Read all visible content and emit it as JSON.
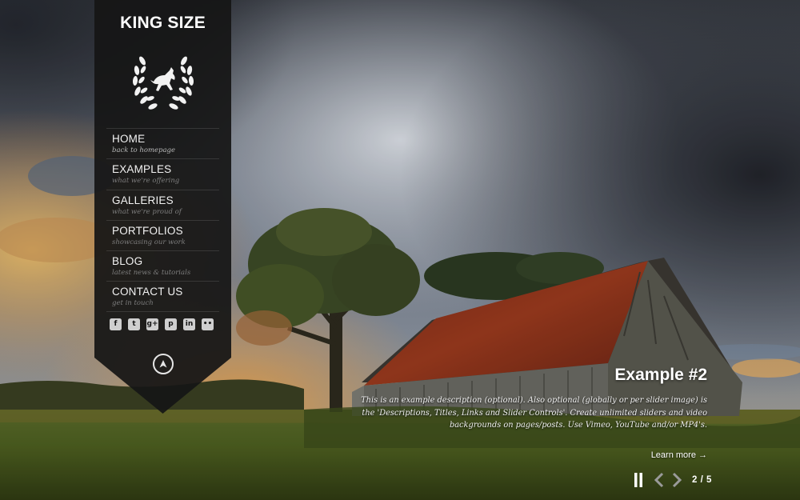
{
  "site": {
    "title": "KING SIZE"
  },
  "menu": [
    {
      "label": "HOME",
      "sub": "back to homepage",
      "active": true
    },
    {
      "label": "EXAMPLES",
      "sub": "what we're offering",
      "active": false
    },
    {
      "label": "GALLERIES",
      "sub": "what we're proud of",
      "active": false
    },
    {
      "label": "PORTFOLIOS",
      "sub": "showcasing our work",
      "active": false
    },
    {
      "label": "BLOG",
      "sub": "latest news & tutorials",
      "active": false
    },
    {
      "label": "CONTACT US",
      "sub": "get in touch",
      "active": false
    }
  ],
  "social": [
    {
      "name": "facebook-icon",
      "glyph": "f"
    },
    {
      "name": "twitter-icon",
      "glyph": "t"
    },
    {
      "name": "google-plus-icon",
      "glyph": "g+"
    },
    {
      "name": "pinterest-icon",
      "glyph": "p"
    },
    {
      "name": "linkedin-icon",
      "glyph": "in"
    },
    {
      "name": "flickr-icon",
      "glyph": "••"
    }
  ],
  "slide": {
    "title": "Example #2",
    "description": "This is an example description (optional). Also optional (globally or per slider image) is the 'Descriptions, Titles, Links and Slider Controls'. Create unlimited sliders and video backgrounds on pages/posts. Use Vimeo, YouTube and/or MP4's.",
    "link_label": "Learn more →",
    "counter": "2 / 5"
  },
  "colors": {
    "sidebar_bg": "#161616",
    "menu_sub_text": "#7d7d7d",
    "accent_white": "#ffffff"
  }
}
